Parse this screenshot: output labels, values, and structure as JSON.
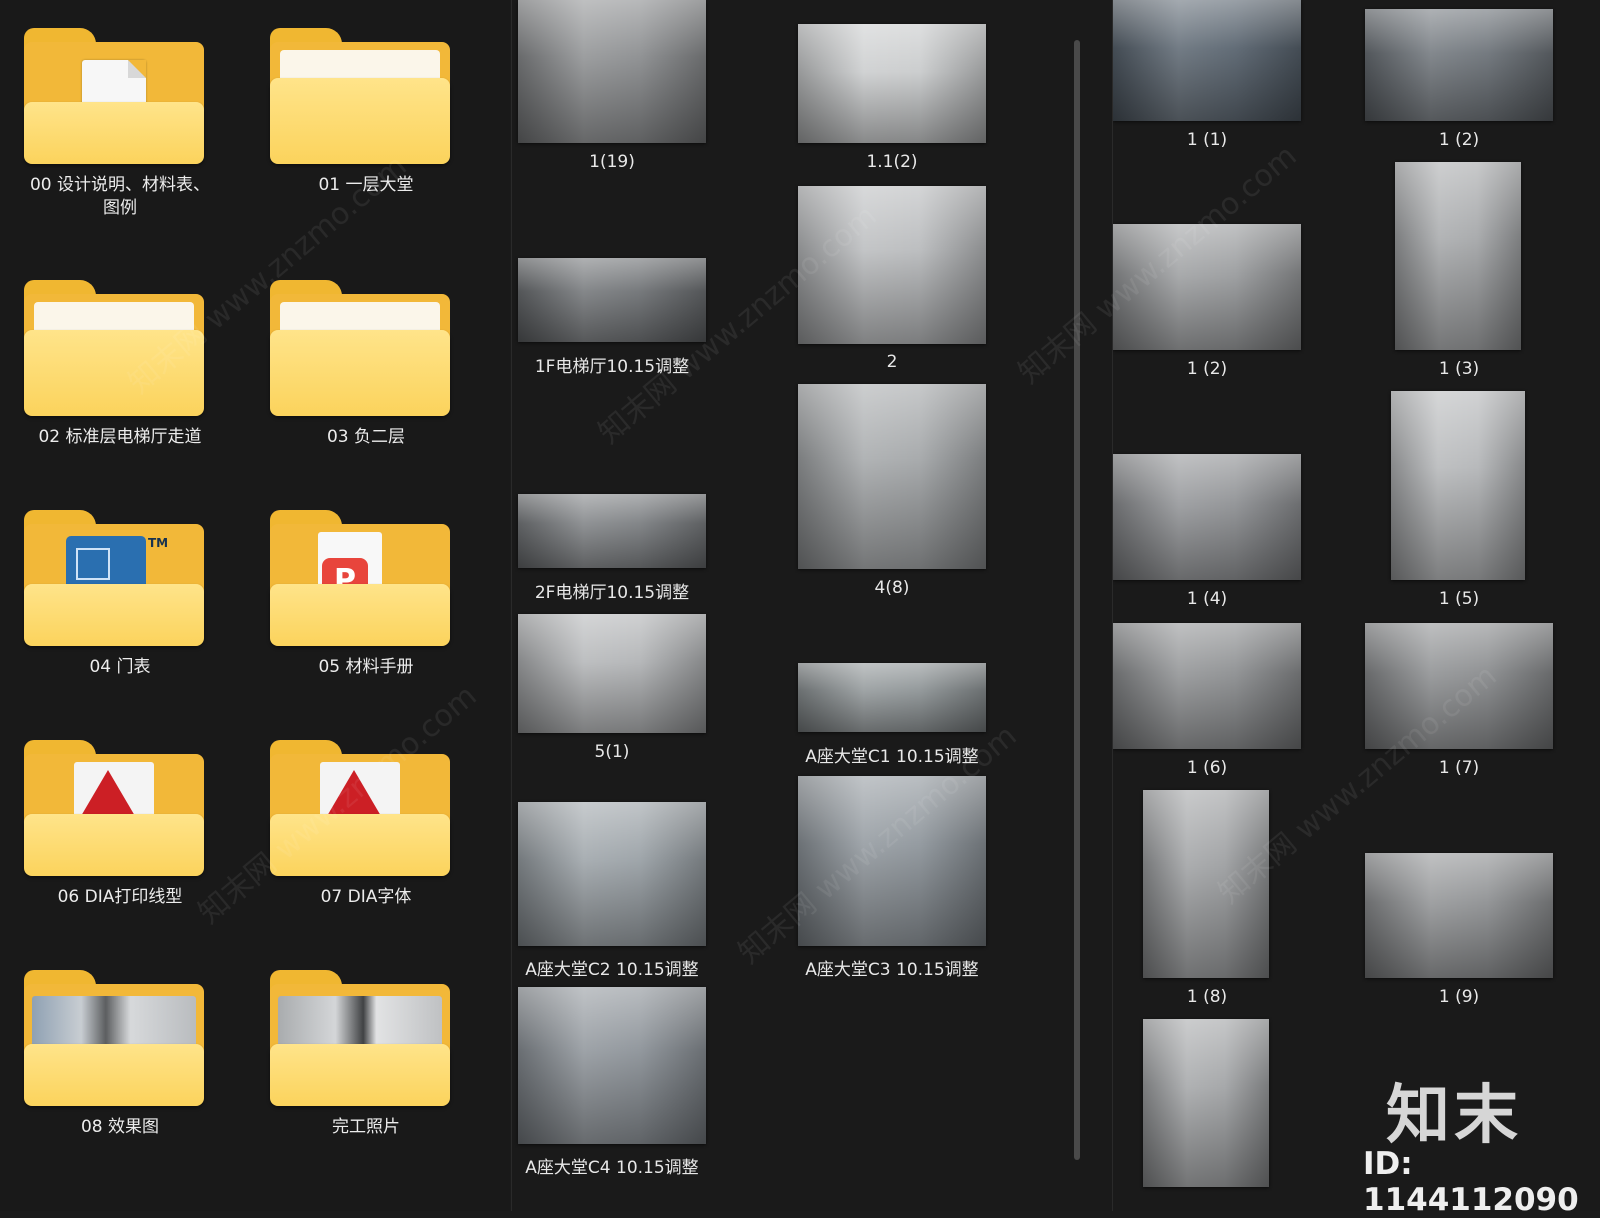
{
  "folders": [
    {
      "label": "00  设计说明、材料表、\n图例",
      "kind": "doc"
    },
    {
      "label": "01 一层大堂",
      "kind": "plain"
    },
    {
      "label": "02 标准层电梯厅走道",
      "kind": "plain"
    },
    {
      "label": "03 负二层",
      "kind": "plain"
    },
    {
      "label": "04 门表",
      "kind": "cad"
    },
    {
      "label": "05 材料手册",
      "kind": "pdf"
    },
    {
      "label": "06 DIA打印线型",
      "kind": "acad"
    },
    {
      "label": "07 DIA字体",
      "kind": "acad"
    },
    {
      "label": "08 效果图",
      "kind": "photo"
    },
    {
      "label": "完工照片",
      "kind": "photo"
    }
  ],
  "middle_items": [
    {
      "label": "1(19)",
      "tone": "#8b8d8f"
    },
    {
      "label": "1.1(2)",
      "tone": "#c9cbcc"
    },
    {
      "label": "1F电梯厅10.15调整",
      "tone": "#6f7275"
    },
    {
      "label": "2",
      "tone": "#b9bbbd"
    },
    {
      "label": "2F电梯厅10.15调整",
      "tone": "#7c7f82"
    },
    {
      "label": "4(8)",
      "tone": "#a4a7a9"
    },
    {
      "label": "5(1)",
      "tone": "#b2b4b6"
    },
    {
      "label": "A座大堂C1   10.15调整",
      "tone": "#8e9496"
    },
    {
      "label": "A座大堂C2  10.15调整",
      "tone": "#9aa1a6"
    },
    {
      "label": "A座大堂C3  10.15调整",
      "tone": "#8f969c"
    },
    {
      "label": "A座大堂C4  10.15调整",
      "tone": "#8d9399"
    }
  ],
  "right_items": [
    {
      "label": "1 (1)",
      "tone": "#5a6570"
    },
    {
      "label": "1 (2)",
      "tone": "#6d7379"
    },
    {
      "label": "1 (2)",
      "tone": "#9a9c9e"
    },
    {
      "label": "1 (3)",
      "tone": "#a6a8aa"
    },
    {
      "label": "1 (4)",
      "tone": "#8f9194"
    },
    {
      "label": "1 (5)",
      "tone": "#b4b6b8"
    },
    {
      "label": "1 (6)",
      "tone": "#8d8f91"
    },
    {
      "label": "1 (7)",
      "tone": "#8a8c8e"
    },
    {
      "label": "1 (8)",
      "tone": "#9d9fa1"
    },
    {
      "label": "1 (9)",
      "tone": "#8e9092"
    },
    {
      "label": "",
      "tone": "#a2a4a6"
    }
  ],
  "watermark": {
    "logo": "知末",
    "id": "ID: 1144112090",
    "site": "知末网 www.znzmo.com"
  }
}
